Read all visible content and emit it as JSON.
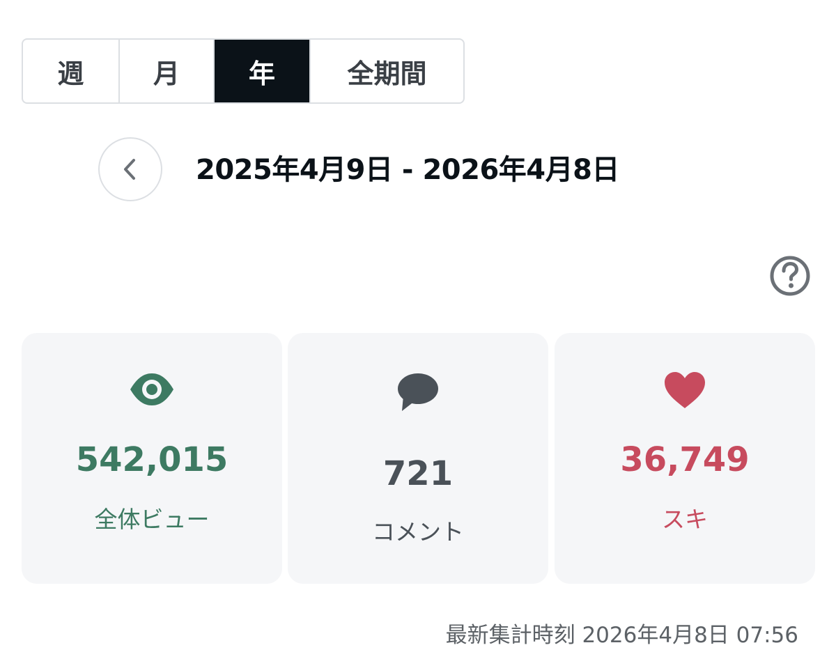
{
  "period_tabs": [
    {
      "label": "週",
      "active": false
    },
    {
      "label": "月",
      "active": false
    },
    {
      "label": "年",
      "active": true
    },
    {
      "label": "全期間",
      "active": false
    }
  ],
  "date_range": "2025年4月9日 - 2026年4月8日",
  "prev_icon": "chevron-left-icon",
  "help_icon": "question-circle-icon",
  "stats": {
    "views": {
      "icon": "eye-icon",
      "value": "542,015",
      "label": "全体ビュー",
      "color": "#3d7a62"
    },
    "comments": {
      "icon": "speech-bubble-icon",
      "value": "721",
      "label": "コメント",
      "color": "#4a5158"
    },
    "likes": {
      "icon": "heart-icon",
      "value": "36,749",
      "label": "スキ",
      "color": "#c74b5e"
    }
  },
  "updated_at": "最新集計時刻 2026年4月8日 07:56",
  "colors": {
    "active_tab_bg": "#0b1218",
    "card_bg": "#f5f6f8",
    "border": "#dcdfe3"
  }
}
